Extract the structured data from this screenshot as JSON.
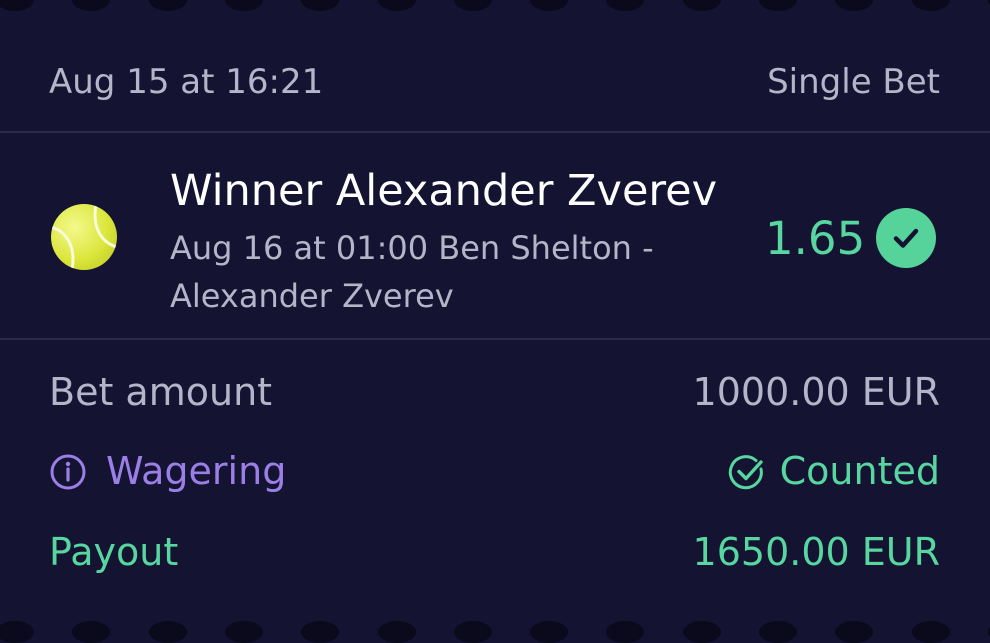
{
  "header": {
    "date": "Aug 15 at 16:21",
    "bet_type": "Single Bet"
  },
  "selection": {
    "sport_icon": "tennis-ball-icon",
    "title": "Winner Alexander Zverev",
    "event_line1": "Aug 16 at 01:00 Ben Shelton -",
    "event_line2": "Alexander Zverev",
    "odds": "1.65",
    "status_icon": "check-circle-icon"
  },
  "summary": {
    "bet_amount_label": "Bet amount",
    "bet_amount_value": "1000.00 EUR",
    "wagering_label": "Wagering",
    "wagering_icon": "info-circle-icon",
    "wagering_value": "Counted",
    "wagering_value_icon": "check-circle-outline-icon",
    "payout_label": "Payout",
    "payout_value": "1650.00 EUR"
  },
  "colors": {
    "background": "#141332",
    "text_muted": "#b6b4c8",
    "accent_green": "#58d6a0",
    "accent_purple": "#9b7fe6",
    "divider": "#2c2b4c"
  }
}
